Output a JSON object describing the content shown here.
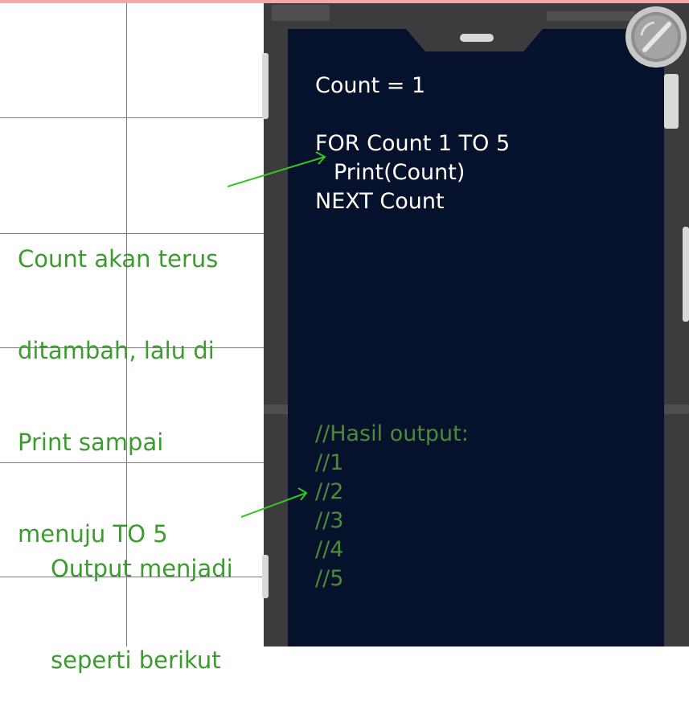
{
  "code": {
    "lines": [
      "Count = 1",
      "FOR Count 1 TO 5",
      "Print(Count)",
      "NEXT Count"
    ],
    "output_comments": [
      "//Hasil output:",
      "//1",
      "//2",
      "//3",
      "//4",
      "//5"
    ]
  },
  "annotations": {
    "note1_lines": [
      "Count akan terus",
      "ditambah, lalu di",
      "Print sampai",
      "menuju TO 5"
    ],
    "note2_lines": [
      "Output menjadi",
      "seperti berikut"
    ]
  },
  "colors": {
    "screen_bg": "#06122b",
    "code_text": "#ffffff",
    "comment_text": "#4d8a3a",
    "annotation_text": "#3a9c2d",
    "phone_frame": "#3c3c3e",
    "top_strip": "#f2a7aa",
    "grid_line": "#7a7a7a"
  },
  "icons": {
    "camera": "camera-lens-icon",
    "speaker": "speaker-grille-icon",
    "arrow": "arrow-icon"
  }
}
